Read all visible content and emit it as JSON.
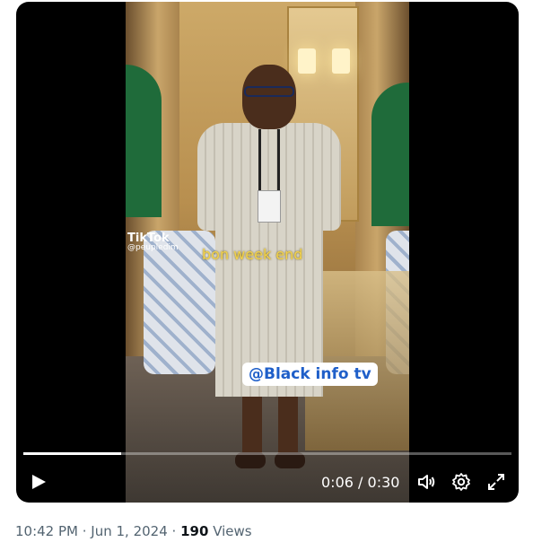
{
  "video": {
    "overlay_tiktok_brand": "TikTok",
    "overlay_tiktok_handle": "@peupledim",
    "overlay_caption": "bon week end",
    "overlay_watermark": "@Black info tv",
    "progress_fraction": 0.2,
    "current_time": "0:06",
    "separator": "/",
    "duration": "0:30"
  },
  "controls": {
    "play_icon": "play-icon",
    "volume_icon": "volume-icon",
    "settings_icon": "gear-icon",
    "fullscreen_icon": "fullscreen-icon"
  },
  "post_meta": {
    "timestamp": "10:42 PM · Jun 1, 2024",
    "dot": "·",
    "views_count": "190",
    "views_label": "Views"
  }
}
